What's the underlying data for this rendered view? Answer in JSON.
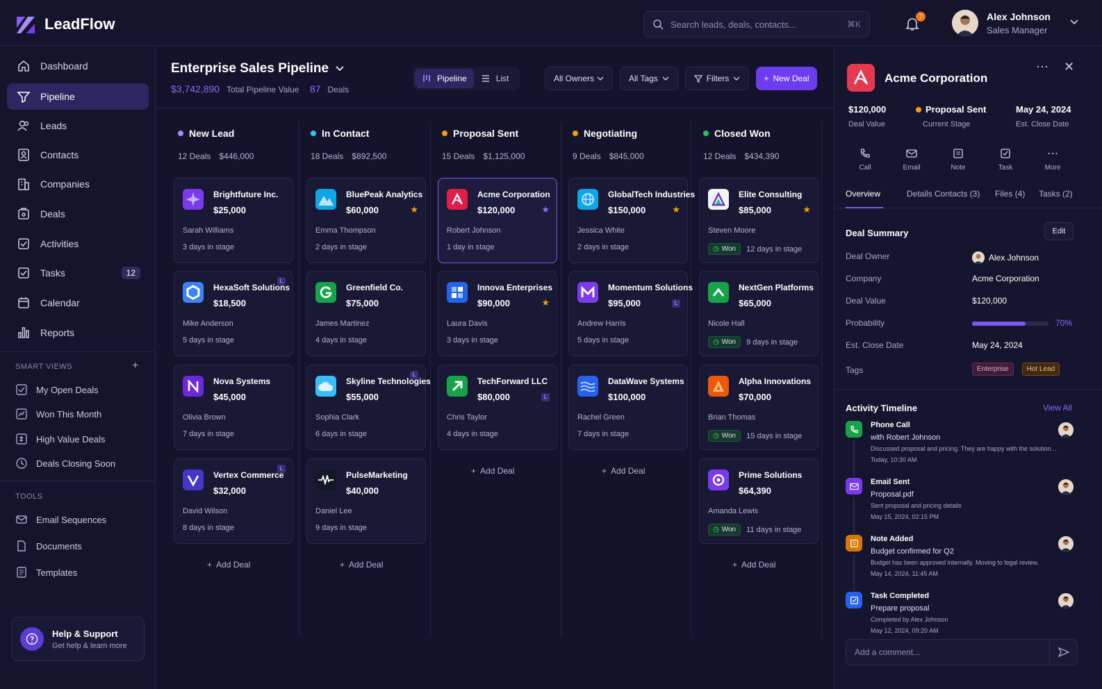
{
  "app": {
    "name": "LeadFlow"
  },
  "search": {
    "placeholder": "Search leads, deals, contacts...",
    "shortcut": "⌘K"
  },
  "notifications": {
    "count": "7"
  },
  "user": {
    "name": "Alex Johnson",
    "role": "Sales Manager"
  },
  "sidebar": {
    "items": [
      {
        "label": "Dashboard",
        "icon": "home-icon"
      },
      {
        "label": "Pipeline",
        "icon": "funnel-icon",
        "active": true
      },
      {
        "label": "Leads",
        "icon": "users-icon"
      },
      {
        "label": "Contacts",
        "icon": "contact-card-icon"
      },
      {
        "label": "Companies",
        "icon": "building-icon"
      },
      {
        "label": "Deals",
        "icon": "deal-icon"
      },
      {
        "label": "Activities",
        "icon": "activity-icon"
      },
      {
        "label": "Tasks",
        "icon": "checkbox-icon",
        "count": "12"
      },
      {
        "label": "Calendar",
        "icon": "calendar-icon"
      },
      {
        "label": "Reports",
        "icon": "bar-chart-icon"
      }
    ],
    "smart_views_label": "SMART VIEWS",
    "smart_views": [
      "My Open Deals",
      "Won This Month",
      "High Value Deals",
      "Deals Closing Soon"
    ],
    "tools_label": "TOOLS",
    "tools": [
      "Email Sequences",
      "Documents",
      "Templates"
    ],
    "help": {
      "title": "Help & Support",
      "subtitle": "Get help & learn more"
    }
  },
  "pipeline": {
    "title": "Enterprise Sales Pipeline",
    "total_value": "$3,742,890",
    "total_value_label": "Total Pipeline Value",
    "deal_count": "87",
    "deal_count_label": "Deals",
    "view_pipeline": "Pipeline",
    "view_list": "List",
    "owners": "All Owners",
    "tags": "All Tags",
    "filters": "Filters",
    "new_deal": "New Deal",
    "add_deal": "Add Deal",
    "won_label": "Won",
    "columns": [
      {
        "name": "New Lead",
        "color": "#a78bfa",
        "count": "12 Deals",
        "value": "$446,000",
        "cards": [
          {
            "company": "Brightfuture Inc.",
            "value": "$25,000",
            "person": "Sarah Williams",
            "days": "3 days in stage",
            "logo": "star-burst-logo",
            "logo_color": "#7c3aed"
          },
          {
            "company": "HexaSoft Solutions",
            "value": "$18,500",
            "person": "Mike Anderson",
            "days": "5 days in stage",
            "logo": "hexagon-logo",
            "logo_color": "#3b82f6",
            "tag": "L"
          },
          {
            "company": "Nova Systems",
            "value": "$45,000",
            "person": "Olivia Brown",
            "days": "7 days in stage",
            "logo": "n-logo",
            "logo_color": "#6d28d9"
          },
          {
            "company": "Vertex Commerce",
            "value": "$32,000",
            "person": "David Wilson",
            "days": "8 days in stage",
            "logo": "v-logo",
            "logo_color": "#4338ca",
            "tag": "L"
          }
        ]
      },
      {
        "name": "In Contact",
        "color": "#38bdf8",
        "count": "18 Deals",
        "value": "$892,500",
        "cards": [
          {
            "company": "BluePeak Analytics",
            "value": "$60,000",
            "person": "Emma Thompson",
            "days": "2 days in stage",
            "logo": "mountain-logo",
            "logo_color": "#0ea5e9",
            "star": true
          },
          {
            "company": "Greenfield Co.",
            "value": "$75,000",
            "person": "James Martinez",
            "days": "4 days in stage",
            "logo": "g-logo",
            "logo_color": "#16a34a"
          },
          {
            "company": "Skyline Technologies",
            "value": "$55,000",
            "person": "Sophia Clark",
            "days": "6 days in stage",
            "logo": "cloud-logo",
            "logo_color": "#38bdf8",
            "tag": "L"
          },
          {
            "company": "PulseMarketing",
            "value": "$40,000",
            "person": "Daniel Lee",
            "days": "9 days in stage",
            "logo": "pulse-logo",
            "logo_color": "#111827"
          }
        ]
      },
      {
        "name": "Proposal Sent",
        "color": "#f59e0b",
        "count": "15 Deals",
        "value": "$1,125,000",
        "cards": [
          {
            "company": "Acme Corporation",
            "value": "$120,000",
            "person": "Robert Johnson",
            "days": "1 day in stage",
            "logo": "a-logo",
            "logo_color": "#e11d48",
            "star": true,
            "star_purple": true,
            "selected": true
          },
          {
            "company": "Innova Enterprises",
            "value": "$90,000",
            "person": "Laura Davis",
            "days": "3 days in stage",
            "logo": "blocks-logo",
            "logo_color": "#2563eb",
            "star": true
          },
          {
            "company": "TechForward LLC",
            "value": "$80,000",
            "person": "Chris Taylor",
            "days": "4 days in stage",
            "logo": "arrow-logo",
            "logo_color": "#16a34a",
            "tag": "L"
          }
        ]
      },
      {
        "name": "Negotiating",
        "color": "#f59e0b",
        "count": "9 Deals",
        "value": "$845,000",
        "cards": [
          {
            "company": "GlobalTech Industries",
            "value": "$150,000",
            "person": "Jessica White",
            "days": "2 days in stage",
            "logo": "globe-logo",
            "logo_color": "#0ea5e9",
            "star": true
          },
          {
            "company": "Momentum Solutions",
            "value": "$95,000",
            "person": "Andrew Harris",
            "days": "5 days in stage",
            "logo": "m-logo",
            "logo_color": "#7c3aed",
            "tag": "L"
          },
          {
            "company": "DataWave Systems",
            "value": "$100,000",
            "person": "Rachel Green",
            "days": "7 days in stage",
            "logo": "wave-logo",
            "logo_color": "#2563eb"
          }
        ]
      },
      {
        "name": "Closed Won",
        "color": "#22c55e",
        "count": "12 Deals",
        "value": "$434,390",
        "cards": [
          {
            "company": "Elite Consulting",
            "value": "$85,000",
            "person": "Steven Moore",
            "days": "12 days in stage",
            "logo": "triangle-logo",
            "logo_color": "#f3f4f6",
            "star": true,
            "won": true
          },
          {
            "company": "NextGen Platforms",
            "value": "$65,000",
            "person": "Nicole Hall",
            "days": "9 days in stage",
            "logo": "chevron-logo",
            "logo_color": "#16a34a",
            "won": true
          },
          {
            "company": "Alpha Innovations",
            "value": "$70,000",
            "person": "Brian Thomas",
            "days": "15 days in stage",
            "logo": "alpha-logo",
            "logo_color": "#ea580c",
            "won": true
          },
          {
            "company": "Prime Solutions",
            "value": "$64,390",
            "person": "Amanda Lewis",
            "days": "11 days in stage",
            "logo": "prime-logo",
            "logo_color": "#7c3aed",
            "won": true
          }
        ]
      }
    ]
  },
  "detail": {
    "title": "Acme Corporation",
    "stats": [
      {
        "value": "$120,000",
        "label": "Deal Value"
      },
      {
        "value": "Proposal Sent",
        "label": "Current Stage"
      },
      {
        "value": "May 24, 2024",
        "label": "Est. Close Date"
      }
    ],
    "actions": [
      "Call",
      "Email",
      "Note",
      "Task",
      "More"
    ],
    "tabs": [
      "Overview",
      "Details",
      "Contacts (3)",
      "Files (4)",
      "Tasks (2)"
    ],
    "summary_title": "Deal Summary",
    "edit": "Edit",
    "summary": {
      "owner_label": "Deal Owner",
      "owner": "Alex Johnson",
      "company_label": "Company",
      "company": "Acme Corporation",
      "value_label": "Deal Value",
      "value": "$120,000",
      "probability_label": "Probability",
      "probability": "70%",
      "probability_value": 0.7,
      "close_label": "Est. Close Date",
      "close": "May 24, 2024",
      "tags_label": "Tags",
      "tags": [
        "Enterprise",
        "Hot Lead"
      ]
    },
    "timeline_title": "Activity Timeline",
    "view_all": "View All",
    "timeline": [
      {
        "title": "Phone Call",
        "subtitle": "with Robert Johnson",
        "desc": "Discussed proposal and pricing. They are happy with the solution...",
        "time": "Today, 10:30 AM",
        "icon": "phone-icon",
        "color": "#16a34a"
      },
      {
        "title": "Email Sent",
        "subtitle": "Proposal.pdf",
        "desc": "Sent proposal and pricing details",
        "time": "May 15, 2024, 02:15 PM",
        "icon": "mail-icon",
        "color": "#7c3aed"
      },
      {
        "title": "Note Added",
        "subtitle": "Budget confirmed for Q2",
        "desc": "Budget has been approved internally. Moving to legal review.",
        "time": "May 14, 2024, 11:45 AM",
        "icon": "note-icon",
        "color": "#d97706"
      },
      {
        "title": "Task Completed",
        "subtitle": "Prepare proposal",
        "desc": "Completed by Alex Johnson",
        "time": "May 12, 2024, 09:20 AM",
        "icon": "task-icon",
        "color": "#2563eb"
      }
    ],
    "comment_placeholder": "Add a comment..."
  }
}
